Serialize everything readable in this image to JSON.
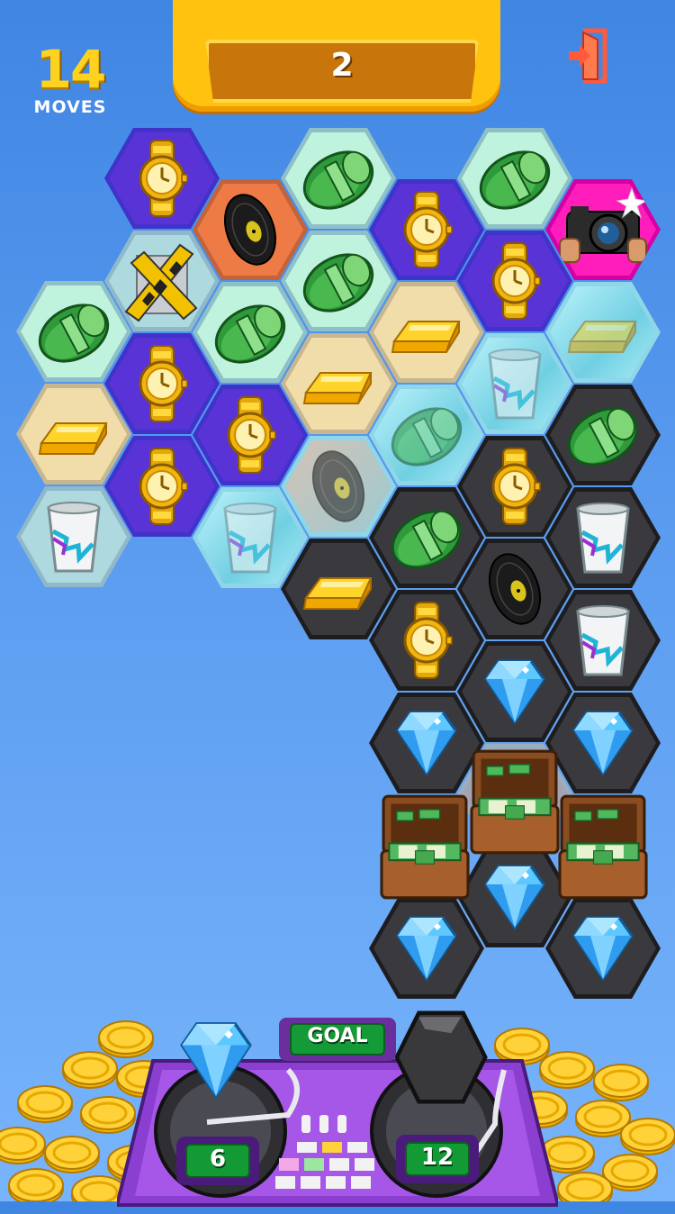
{
  "hud": {
    "moves_value": "14",
    "moves_label": "MOVES",
    "score_value": "2"
  },
  "board": {
    "tile_types": [
      "watch",
      "cash",
      "vinyl",
      "cup",
      "gold-bar",
      "camera",
      "taped-box",
      "diamond",
      "money-briefcase"
    ],
    "backgrounds": [
      "purple",
      "mint",
      "orange",
      "tan",
      "teal",
      "ice",
      "dark",
      "pink"
    ]
  },
  "goal": {
    "label": "GOAL",
    "diamond_count": "6",
    "dark_tile_count": "12"
  },
  "colors": {
    "background": "#5b9cf0",
    "panel_yellow": "#ffc20e",
    "goal_green": "#149a36",
    "deck_purple": "#6a2f9c"
  }
}
